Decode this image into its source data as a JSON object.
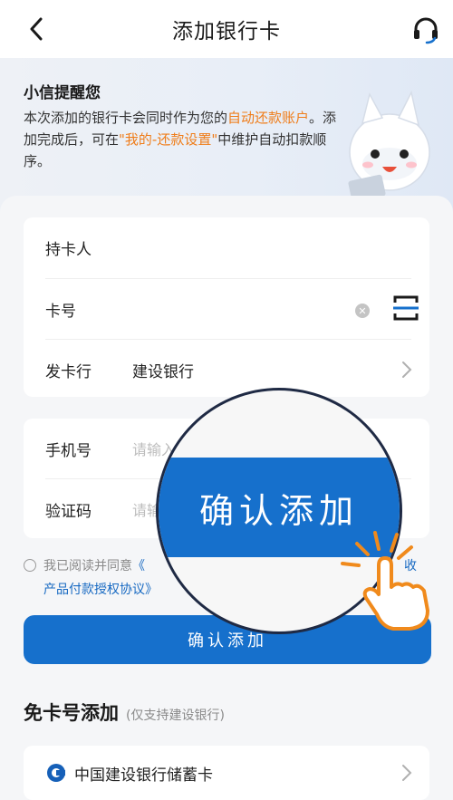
{
  "header": {
    "title": "添加银行卡"
  },
  "banner": {
    "title": "小信提醒您",
    "text_1": "本次添加的银行卡会同时作为您的",
    "highlight_1": "自动还款账户",
    "text_2": "。添加完成后，可在",
    "highlight_2": "\"我的-还款设置\"",
    "text_3": "中维护自动扣款顺序。"
  },
  "form": {
    "holder_label": "持卡人",
    "card_label": "卡号",
    "bank_label": "发卡行",
    "bank_value": "建设银行",
    "phone_label": "手机号",
    "phone_placeholder": "请输入",
    "code_label": "验证码",
    "code_placeholder": "请输"
  },
  "agreement": {
    "prefix": "我已阅读并同意",
    "link_start": "《",
    "link_end_top": "收",
    "link_line2": "产品付款授权协议》"
  },
  "confirm_label": "确认添加",
  "magnifier_label": "确认添加",
  "nocard": {
    "title": "免卡号添加",
    "subtitle": "(仅支持建设银行)",
    "item_label": "中国建设银行储蓄卡"
  },
  "colors": {
    "primary": "#1670cc",
    "highlight": "#ef7d1a",
    "link": "#1769c2"
  }
}
